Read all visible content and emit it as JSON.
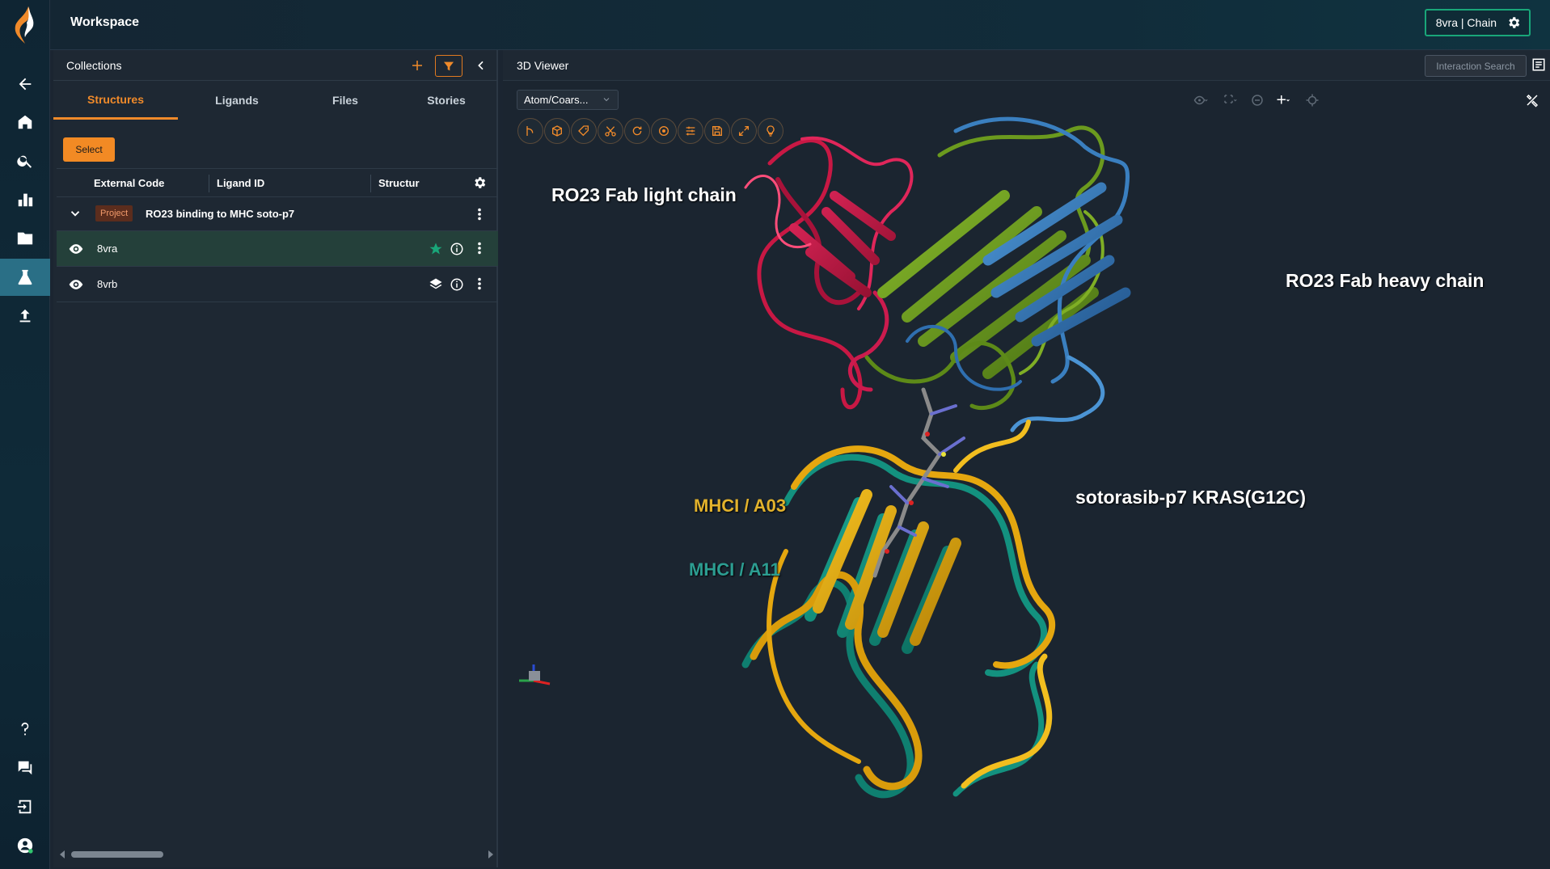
{
  "app": {
    "title": "Workspace",
    "chain_button": "8vra | Chain"
  },
  "colors": {
    "accent": "#f08a2a",
    "selected_row": "#24403a",
    "chain_border": "#19a679",
    "light_chain": "#d41c4a",
    "heavy_chain_green": "#6b9a1e",
    "heavy_chain_blue": "#3a7fbf",
    "mhc_a03": "#e5a70f",
    "mhc_a11": "#13917f"
  },
  "rail": {
    "items": [
      {
        "name": "back",
        "icon": "arrow-left-icon"
      },
      {
        "name": "home",
        "icon": "home-icon"
      },
      {
        "name": "search",
        "icon": "search-icon"
      },
      {
        "name": "analytics",
        "icon": "bar-chart-icon"
      },
      {
        "name": "folders",
        "icon": "folder-icon"
      },
      {
        "name": "structures",
        "icon": "flask-icon",
        "active": true
      },
      {
        "name": "upload",
        "icon": "upload-icon"
      },
      {
        "name": "help",
        "icon": "help-icon"
      },
      {
        "name": "feedback",
        "icon": "chat-icon"
      },
      {
        "name": "logout",
        "icon": "logout-icon"
      },
      {
        "name": "account",
        "icon": "account-icon"
      }
    ]
  },
  "collections": {
    "title": "Collections",
    "tabs": [
      "Structures",
      "Ligands",
      "Files",
      "Stories"
    ],
    "active_tab": "Structures",
    "select_label": "Select",
    "columns": [
      "External Code",
      "Ligand ID",
      "Structur"
    ],
    "project": {
      "badge": "Project",
      "name": "RO23 binding to MHC soto-p7"
    },
    "rows": [
      {
        "code": "8vra",
        "selected": true,
        "icon": "star-icon"
      },
      {
        "code": "8vrb",
        "selected": false,
        "icon": "layers-icon"
      }
    ]
  },
  "viewer": {
    "title": "3D Viewer",
    "interaction_search": "Interaction Search",
    "representation": "Atom/Coars...",
    "labels": {
      "light_chain": "RO23 Fab light chain",
      "heavy_chain": "RO23 Fab heavy chain",
      "peptide": "sotorasib-p7 KRAS(G12C)",
      "mhc_a03": "MHCI / A03",
      "mhc_a11": "MHCI / A11"
    },
    "tools": [
      "branch-icon",
      "cube-icon",
      "tag-icon",
      "scissors-icon",
      "refresh-icon",
      "target-icon",
      "sliders-icon",
      "save-icon",
      "expand-icon",
      "bulb-icon"
    ]
  }
}
